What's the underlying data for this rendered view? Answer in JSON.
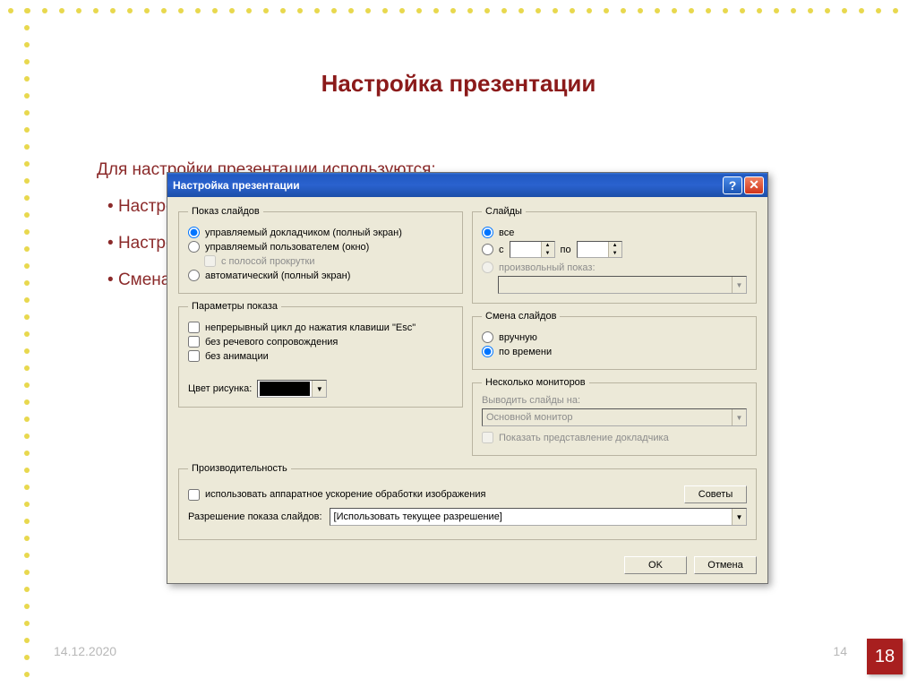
{
  "slide": {
    "title": "Настройка презентации",
    "intro": "Для настройки презентации используются:",
    "bullets": [
      "Настройка презентации,",
      "Настройка времени,",
      "Смена слайдов"
    ],
    "date": "14.12.2020",
    "page_inner": "14",
    "page_badge": "18"
  },
  "dialog": {
    "title": "Настройка презентации",
    "show_type": {
      "legend": "Показ слайдов",
      "opt1": "управляемый докладчиком (полный экран)",
      "opt2": "управляемый пользователем (окно)",
      "opt2_sub": "с полосой прокрутки",
      "opt3": "автоматический (полный экран)"
    },
    "show_params": {
      "legend": "Параметры показа",
      "chk1": "непрерывный цикл до нажатия клавиши \"Esc\"",
      "chk2": "без речевого сопровождения",
      "chk3": "без анимации",
      "color_label": "Цвет рисунка:"
    },
    "slides": {
      "legend": "Слайды",
      "all": "все",
      "from": "с",
      "to": "по",
      "custom": "произвольный показ:"
    },
    "advance": {
      "legend": "Смена слайдов",
      "manual": "вручную",
      "timed": "по времени"
    },
    "monitors": {
      "legend": "Несколько мониторов",
      "output_label": "Выводить слайды на:",
      "output_value": "Основной монитор",
      "presenter_view": "Показать представление докладчика"
    },
    "perf": {
      "legend": "Производительность",
      "hw_accel": "использовать аппаратное ускорение обработки изображения",
      "tips_btn": "Советы",
      "res_label": "Разрешение показа слайдов:",
      "res_value": "[Использовать текущее разрешение]"
    },
    "ok": "OK",
    "cancel": "Отмена"
  }
}
